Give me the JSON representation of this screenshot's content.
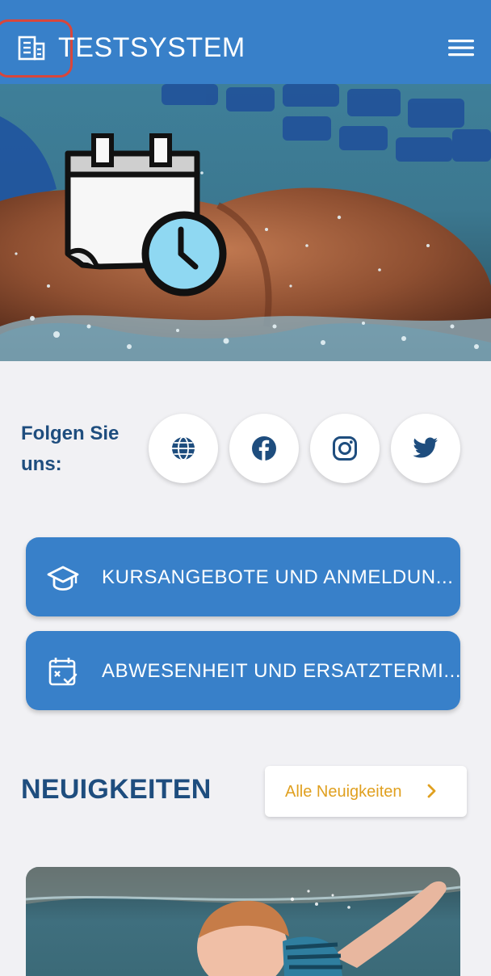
{
  "header": {
    "title": "TESTSYSTEM",
    "logo_icon": "building-icon",
    "menu_icon": "hamburger-menu-icon",
    "background_color": "#3880c9"
  },
  "hero": {
    "image": "swimmer-underwater-photo",
    "overlay_icon": "calendar-clock-icon"
  },
  "follow": {
    "label": "Folgen Sie uns:",
    "icons": [
      "globe-icon",
      "facebook-icon",
      "instagram-icon",
      "twitter-icon"
    ]
  },
  "actions": [
    {
      "label": "KURSANGEBOTE UND ANMELDUN...",
      "icon": "graduation-cap-icon"
    },
    {
      "label": "ABWESENHEIT UND ERSATZTERMI...",
      "icon": "calendar-check-icon"
    }
  ],
  "news": {
    "title": "NEUIGKEITEN",
    "all_link": "Alle Neuigkeiten",
    "card_image": "baby-swimming-underwater-photo"
  },
  "colors": {
    "primary": "#3880c9",
    "heading": "#1e4d7e",
    "link": "#e0a020",
    "page_background": "#f1f1f4"
  }
}
